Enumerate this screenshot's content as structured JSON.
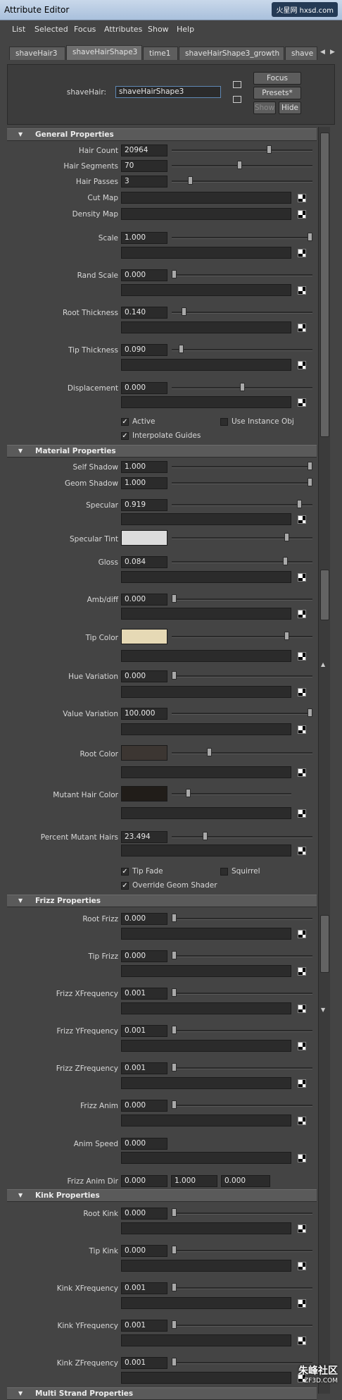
{
  "window": {
    "title": "Attribute Editor",
    "logo_text": "火星网 hxsd.com"
  },
  "menu": [
    "List",
    "Selected",
    "Focus",
    "Attributes",
    "Show",
    "Help"
  ],
  "tabs": [
    "shaveHair3",
    "shaveHairShape3",
    "time1",
    "shaveHairShape3_growth",
    "shave"
  ],
  "active_tab": 1,
  "header": {
    "node_label": "shaveHair:",
    "node_value": "shaveHairShape3",
    "focus_label": "Focus",
    "presets_label": "Presets*",
    "show_label": "Show",
    "hide_label": "Hide"
  },
  "sections": {
    "general": "General Properties",
    "material": "Material Properties",
    "frizz": "Frizz Properties",
    "kink": "Kink Properties",
    "multistrand": "Multi Strand Properties"
  },
  "general": {
    "hair_count": {
      "label": "Hair Count",
      "value": "20964",
      "slider": 0.7
    },
    "hair_segments": {
      "label": "Hair Segments",
      "value": "70",
      "slider": 0.48
    },
    "hair_passes": {
      "label": "Hair Passes",
      "value": "3",
      "slider": 0.12
    },
    "cut_map": {
      "label": "Cut Map"
    },
    "density_map": {
      "label": "Density Map"
    },
    "scale": {
      "label": "Scale",
      "value": "1.000",
      "slider": 1.0
    },
    "rand_scale": {
      "label": "Rand Scale",
      "value": "0.000",
      "slider": 0.0
    },
    "root_thickness": {
      "label": "Root Thickness",
      "value": "0.140",
      "slider": 0.07
    },
    "tip_thickness": {
      "label": "Tip Thickness",
      "value": "0.090",
      "slider": 0.05
    },
    "displacement": {
      "label": "Displacement",
      "value": "0.000",
      "slider": 0.5
    },
    "active": {
      "label": "Active",
      "checked": true
    },
    "use_instance_obj": {
      "label": "Use Instance Obj",
      "checked": false
    },
    "interpolate_guides": {
      "label": "Interpolate Guides",
      "checked": true
    }
  },
  "material": {
    "self_shadow": {
      "label": "Self Shadow",
      "value": "1.000",
      "slider": 1.0
    },
    "geom_shadow": {
      "label": "Geom Shadow",
      "value": "1.000",
      "slider": 1.0
    },
    "specular": {
      "label": "Specular",
      "value": "0.919",
      "slider": 0.92
    },
    "specular_tint": {
      "label": "Specular Tint",
      "color": "#dcdcdc",
      "slider": 0.83
    },
    "gloss": {
      "label": "Gloss",
      "value": "0.084",
      "slider": 0.82
    },
    "amb_diff": {
      "label": "Amb/diff",
      "value": "0.000",
      "slider": 0.0
    },
    "tip_color": {
      "label": "Tip Color",
      "color": "#e6d9b5",
      "slider": 0.83
    },
    "hue_variation": {
      "label": "Hue Variation",
      "value": "0.000",
      "slider": 0.0
    },
    "value_variation": {
      "label": "Value Variation",
      "value": "100.000",
      "slider": 1.0
    },
    "root_color": {
      "label": "Root Color",
      "color": "#3c3632",
      "slider": 0.26
    },
    "mutant_hair_color": {
      "label": "Mutant Hair Color",
      "color": "#211d19",
      "slider": 0.12
    },
    "percent_mutant_hairs": {
      "label": "Percent Mutant Hairs",
      "value": "23.494",
      "slider": 0.23
    },
    "tip_fade": {
      "label": "Tip Fade",
      "checked": true
    },
    "squirrel": {
      "label": "Squirrel",
      "checked": false
    },
    "override_geom_shader": {
      "label": "Override Geom Shader",
      "checked": true
    }
  },
  "frizz": {
    "root_frizz": {
      "label": "Root Frizz",
      "value": "0.000",
      "slider": 0.0
    },
    "tip_frizz": {
      "label": "Tip Frizz",
      "value": "0.000",
      "slider": 0.0
    },
    "frizz_xfrequency": {
      "label": "Frizz XFrequency",
      "value": "0.001",
      "slider": 0.0
    },
    "frizz_yfrequency": {
      "label": "Frizz YFrequency",
      "value": "0.001",
      "slider": 0.0
    },
    "frizz_zfrequency": {
      "label": "Frizz ZFrequency",
      "value": "0.001",
      "slider": 0.0
    },
    "frizz_anim": {
      "label": "Frizz Anim",
      "value": "0.000",
      "slider": 0.0
    },
    "anim_speed": {
      "label": "Anim Speed",
      "value": "0.000"
    },
    "frizz_anim_dir": {
      "label": "Frizz Anim Dir",
      "x": "0.000",
      "y": "1.000",
      "z": "0.000"
    }
  },
  "kink": {
    "root_kink": {
      "label": "Root Kink",
      "value": "0.000",
      "slider": 0.0
    },
    "tip_kink": {
      "label": "Tip Kink",
      "value": "0.000",
      "slider": 0.0
    },
    "kink_xfrequency": {
      "label": "Kink XFrequency",
      "value": "0.001",
      "slider": 0.0
    },
    "kink_yfrequency": {
      "label": "Kink YFrequency",
      "value": "0.001",
      "slider": 0.0
    },
    "kink_zfrequency": {
      "label": "Kink ZFrequency",
      "value": "0.001",
      "slider": 0.0
    }
  },
  "watermark": {
    "text": "朱峰社区",
    "sub": "ZF3D.COM"
  }
}
